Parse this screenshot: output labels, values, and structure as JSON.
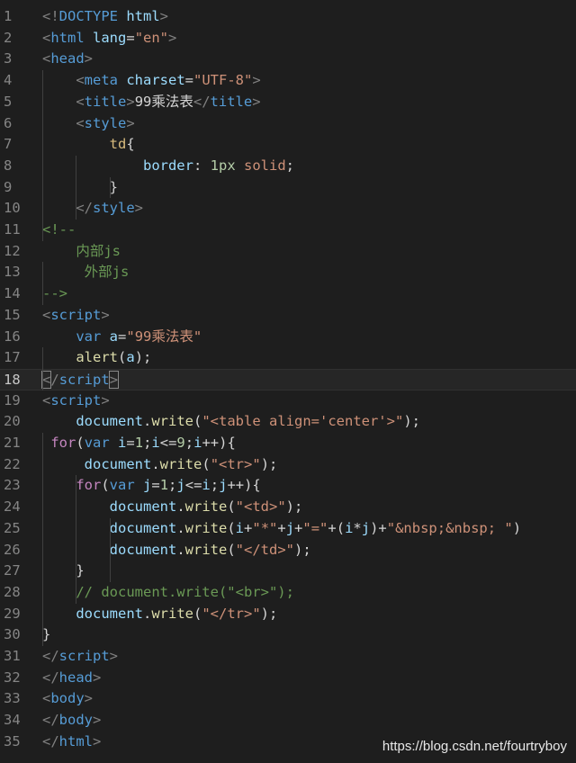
{
  "watermark": "https://blog.csdn.net/fourtryboy",
  "active_line": 18,
  "colors": {
    "background": "#1e1e1e",
    "tag": "#808080",
    "tag_name": "#569cd6",
    "attribute": "#9cdcfe",
    "string": "#ce9178",
    "keyword": "#c586c0",
    "function": "#dcdcaa",
    "number": "#b5cea8",
    "comment": "#6a9955",
    "line_number": "#858585"
  },
  "lines": [
    {
      "n": "1",
      "tokens": [
        [
          "t-tag",
          "<!"
        ],
        [
          "t-name",
          "DOCTYPE"
        ],
        [
          "t-pun",
          " "
        ],
        [
          "t-attr",
          "html"
        ],
        [
          "t-tag",
          ">"
        ]
      ]
    },
    {
      "n": "2",
      "tokens": [
        [
          "t-tag",
          "<"
        ],
        [
          "t-name",
          "html"
        ],
        [
          "t-pun",
          " "
        ],
        [
          "t-attr",
          "lang"
        ],
        [
          "t-pun",
          "="
        ],
        [
          "t-str",
          "\"en\""
        ],
        [
          "t-tag",
          ">"
        ]
      ]
    },
    {
      "n": "3",
      "tokens": [
        [
          "t-tag",
          "<"
        ],
        [
          "t-name",
          "head"
        ],
        [
          "t-tag",
          ">"
        ]
      ]
    },
    {
      "n": "4",
      "tokens": [
        [
          "t-pun",
          "    "
        ],
        [
          "t-tag",
          "<"
        ],
        [
          "t-name",
          "meta"
        ],
        [
          "t-pun",
          " "
        ],
        [
          "t-attr",
          "charset"
        ],
        [
          "t-pun",
          "="
        ],
        [
          "t-str",
          "\"UTF-8\""
        ],
        [
          "t-tag",
          ">"
        ]
      ]
    },
    {
      "n": "5",
      "tokens": [
        [
          "t-pun",
          "    "
        ],
        [
          "t-tag",
          "<"
        ],
        [
          "t-name",
          "title"
        ],
        [
          "t-tag",
          ">"
        ],
        [
          "t-text",
          "99乘法表"
        ],
        [
          "t-tag",
          "</"
        ],
        [
          "t-name",
          "title"
        ],
        [
          "t-tag",
          ">"
        ]
      ]
    },
    {
      "n": "6",
      "tokens": [
        [
          "t-pun",
          "    "
        ],
        [
          "t-tag",
          "<"
        ],
        [
          "t-name",
          "style"
        ],
        [
          "t-tag",
          ">"
        ]
      ]
    },
    {
      "n": "7",
      "tokens": [
        [
          "t-pun",
          "        "
        ],
        [
          "t-sel",
          "td"
        ],
        [
          "t-pun",
          "{"
        ]
      ]
    },
    {
      "n": "8",
      "tokens": [
        [
          "t-pun",
          "            "
        ],
        [
          "t-attr",
          "border"
        ],
        [
          "t-pun",
          ": "
        ],
        [
          "t-num",
          "1px"
        ],
        [
          "t-pun",
          " "
        ],
        [
          "t-val",
          "solid"
        ],
        [
          "t-pun",
          ";"
        ]
      ]
    },
    {
      "n": "9",
      "tokens": [
        [
          "t-pun",
          "        }"
        ]
      ]
    },
    {
      "n": "10",
      "tokens": [
        [
          "t-pun",
          "    "
        ],
        [
          "t-tag",
          "</"
        ],
        [
          "t-name",
          "style"
        ],
        [
          "t-tag",
          ">"
        ]
      ]
    },
    {
      "n": "11",
      "tokens": [
        [
          "t-cmt",
          "<!--"
        ]
      ]
    },
    {
      "n": "12",
      "tokens": [
        [
          "t-cmt",
          "    内部js"
        ]
      ]
    },
    {
      "n": "13",
      "tokens": [
        [
          "t-cmt",
          "     外部js"
        ]
      ]
    },
    {
      "n": "14",
      "tokens": [
        [
          "t-cmt",
          "-->"
        ]
      ]
    },
    {
      "n": "15",
      "tokens": [
        [
          "t-tag",
          "<"
        ],
        [
          "t-name",
          "script"
        ],
        [
          "t-tag",
          ">"
        ]
      ]
    },
    {
      "n": "16",
      "tokens": [
        [
          "t-pun",
          "    "
        ],
        [
          "t-var",
          "var"
        ],
        [
          "t-pun",
          " "
        ],
        [
          "t-id",
          "a"
        ],
        [
          "t-pun",
          "="
        ],
        [
          "t-str",
          "\"99乘法表\""
        ]
      ]
    },
    {
      "n": "17",
      "tokens": [
        [
          "t-pun",
          "    "
        ],
        [
          "t-fn",
          "alert"
        ],
        [
          "t-pun",
          "("
        ],
        [
          "t-id",
          "a"
        ],
        [
          "t-pun",
          ");"
        ]
      ]
    },
    {
      "n": "18",
      "tokens": [
        [
          "t-tag bracket-box",
          "<"
        ],
        [
          "t-tag",
          "/"
        ],
        [
          "t-name",
          "script"
        ],
        [
          "t-tag bracket-box",
          ">"
        ]
      ]
    },
    {
      "n": "19",
      "tokens": [
        [
          "t-tag",
          "<"
        ],
        [
          "t-name",
          "script"
        ],
        [
          "t-tag",
          ">"
        ]
      ]
    },
    {
      "n": "20",
      "tokens": [
        [
          "t-pun",
          "    "
        ],
        [
          "t-id",
          "document"
        ],
        [
          "t-pun",
          "."
        ],
        [
          "t-fn",
          "write"
        ],
        [
          "t-pun",
          "("
        ],
        [
          "t-str",
          "\"<table align='center'>\""
        ],
        [
          "t-pun",
          ");"
        ]
      ]
    },
    {
      "n": "21",
      "tokens": [
        [
          "t-pun",
          " "
        ],
        [
          "t-kw",
          "for"
        ],
        [
          "t-pun",
          "("
        ],
        [
          "t-var",
          "var"
        ],
        [
          "t-pun",
          " "
        ],
        [
          "t-id",
          "i"
        ],
        [
          "t-pun",
          "="
        ],
        [
          "t-num",
          "1"
        ],
        [
          "t-pun",
          ";"
        ],
        [
          "t-id",
          "i"
        ],
        [
          "t-pun",
          "<="
        ],
        [
          "t-num",
          "9"
        ],
        [
          "t-pun",
          ";"
        ],
        [
          "t-id",
          "i"
        ],
        [
          "t-pun",
          "++){"
        ]
      ]
    },
    {
      "n": "22",
      "tokens": [
        [
          "t-pun",
          "     "
        ],
        [
          "t-id",
          "document"
        ],
        [
          "t-pun",
          "."
        ],
        [
          "t-fn",
          "write"
        ],
        [
          "t-pun",
          "("
        ],
        [
          "t-str",
          "\"<tr>\""
        ],
        [
          "t-pun",
          ");"
        ]
      ]
    },
    {
      "n": "23",
      "tokens": [
        [
          "t-pun",
          "    "
        ],
        [
          "t-kw",
          "for"
        ],
        [
          "t-pun",
          "("
        ],
        [
          "t-var",
          "var"
        ],
        [
          "t-pun",
          " "
        ],
        [
          "t-id",
          "j"
        ],
        [
          "t-pun",
          "="
        ],
        [
          "t-num",
          "1"
        ],
        [
          "t-pun",
          ";"
        ],
        [
          "t-id",
          "j"
        ],
        [
          "t-pun",
          "<="
        ],
        [
          "t-id",
          "i"
        ],
        [
          "t-pun",
          ";"
        ],
        [
          "t-id",
          "j"
        ],
        [
          "t-pun",
          "++){"
        ]
      ]
    },
    {
      "n": "24",
      "tokens": [
        [
          "t-pun",
          "        "
        ],
        [
          "t-id",
          "document"
        ],
        [
          "t-pun",
          "."
        ],
        [
          "t-fn",
          "write"
        ],
        [
          "t-pun",
          "("
        ],
        [
          "t-str",
          "\"<td>\""
        ],
        [
          "t-pun",
          ");"
        ]
      ]
    },
    {
      "n": "25",
      "tokens": [
        [
          "t-pun",
          "        "
        ],
        [
          "t-id",
          "document"
        ],
        [
          "t-pun",
          "."
        ],
        [
          "t-fn",
          "write"
        ],
        [
          "t-pun",
          "("
        ],
        [
          "t-id",
          "i"
        ],
        [
          "t-pun",
          "+"
        ],
        [
          "t-str",
          "\"*\""
        ],
        [
          "t-pun",
          "+"
        ],
        [
          "t-id",
          "j"
        ],
        [
          "t-pun",
          "+"
        ],
        [
          "t-str",
          "\"=\""
        ],
        [
          "t-pun",
          "+("
        ],
        [
          "t-id",
          "i"
        ],
        [
          "t-pun",
          "*"
        ],
        [
          "t-id",
          "j"
        ],
        [
          "t-pun",
          ")+"
        ],
        [
          "t-str",
          "\"&nbsp;&nbsp; \""
        ],
        [
          "t-pun",
          ")"
        ]
      ]
    },
    {
      "n": "26",
      "tokens": [
        [
          "t-pun",
          "        "
        ],
        [
          "t-id",
          "document"
        ],
        [
          "t-pun",
          "."
        ],
        [
          "t-fn",
          "write"
        ],
        [
          "t-pun",
          "("
        ],
        [
          "t-str",
          "\"</td>\""
        ],
        [
          "t-pun",
          ");"
        ]
      ]
    },
    {
      "n": "27",
      "tokens": [
        [
          "t-pun",
          "    }"
        ]
      ]
    },
    {
      "n": "28",
      "tokens": [
        [
          "t-pun",
          "    "
        ],
        [
          "t-cmt",
          "// document.write(\"<br>\");"
        ]
      ]
    },
    {
      "n": "29",
      "tokens": [
        [
          "t-pun",
          "    "
        ],
        [
          "t-id",
          "document"
        ],
        [
          "t-pun",
          "."
        ],
        [
          "t-fn",
          "write"
        ],
        [
          "t-pun",
          "("
        ],
        [
          "t-str",
          "\"</tr>\""
        ],
        [
          "t-pun",
          ");"
        ]
      ]
    },
    {
      "n": "30",
      "tokens": [
        [
          "t-pun",
          "}"
        ]
      ]
    },
    {
      "n": "31",
      "tokens": [
        [
          "t-tag",
          "</"
        ],
        [
          "t-name",
          "script"
        ],
        [
          "t-tag",
          ">"
        ]
      ]
    },
    {
      "n": "32",
      "tokens": [
        [
          "t-tag",
          "</"
        ],
        [
          "t-name",
          "head"
        ],
        [
          "t-tag",
          ">"
        ]
      ]
    },
    {
      "n": "33",
      "tokens": [
        [
          "t-tag",
          "<"
        ],
        [
          "t-name",
          "body"
        ],
        [
          "t-tag",
          ">"
        ]
      ]
    },
    {
      "n": "34",
      "tokens": [
        [
          "t-tag",
          "</"
        ],
        [
          "t-name",
          "body"
        ],
        [
          "t-tag",
          ">"
        ]
      ]
    },
    {
      "n": "35",
      "tokens": [
        [
          "t-tag",
          "</"
        ],
        [
          "t-name",
          "html"
        ],
        [
          "t-tag",
          ">"
        ]
      ]
    }
  ]
}
